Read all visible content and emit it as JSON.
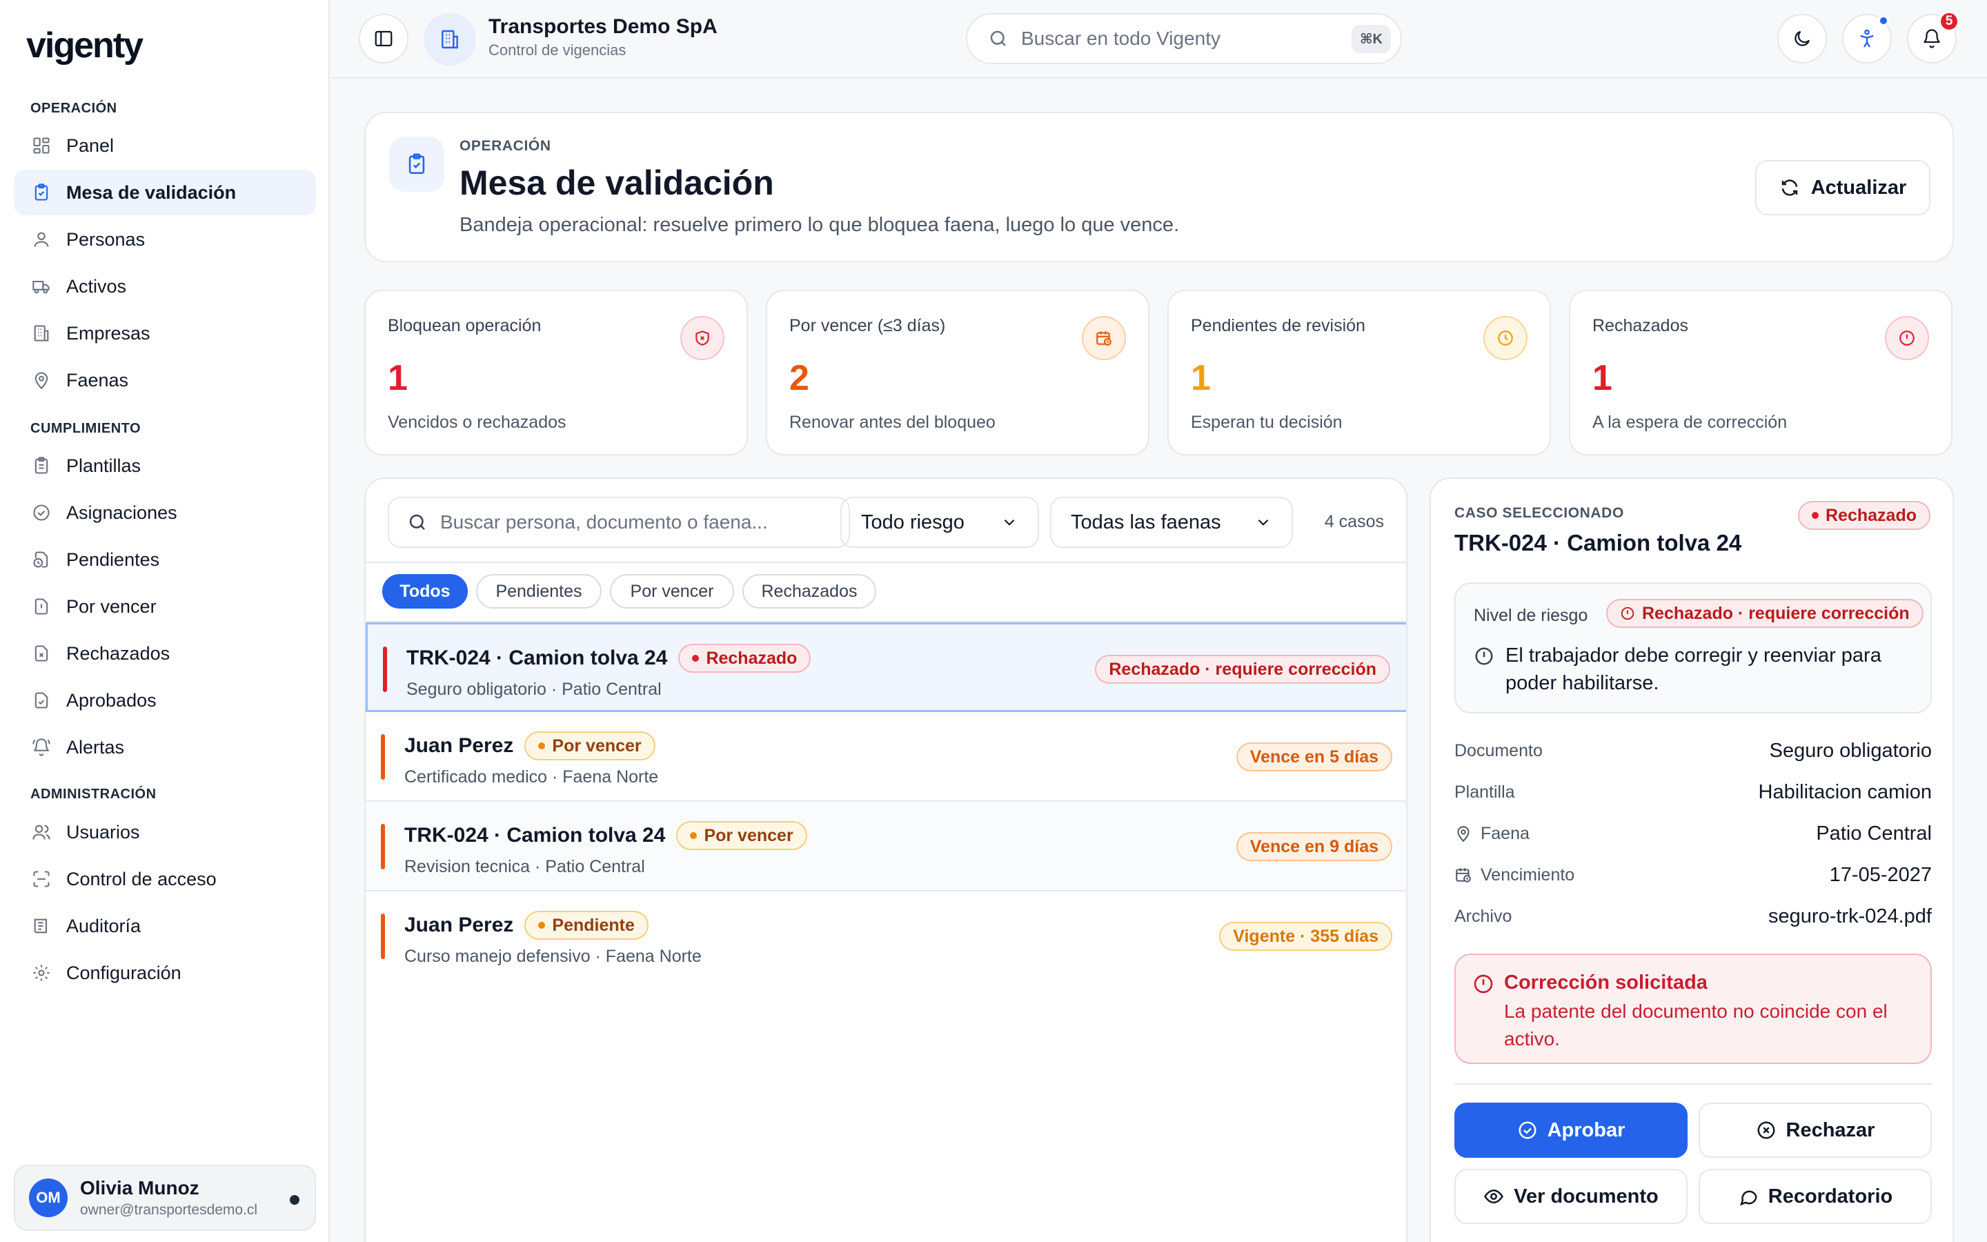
{
  "app": {
    "logo": "vigenty",
    "org_name": "Transportes Demo SpA",
    "org_subtitle": "Control de vigencias",
    "search_placeholder": "Buscar en todo Vigenty",
    "search_shortcut": "⌘K",
    "notifications_count": "5",
    "accent": "#2563eb"
  },
  "sidebar": {
    "sections": [
      {
        "title": "OPERACIÓN",
        "items": [
          {
            "label": "Panel",
            "icon": "dashboard-icon"
          },
          {
            "label": "Mesa de validación",
            "icon": "clipboard-check-icon",
            "active": true
          },
          {
            "label": "Personas",
            "icon": "user-icon"
          },
          {
            "label": "Activos",
            "icon": "truck-icon"
          },
          {
            "label": "Empresas",
            "icon": "building-icon"
          },
          {
            "label": "Faenas",
            "icon": "map-pin-icon"
          }
        ]
      },
      {
        "title": "CUMPLIMIENTO",
        "items": [
          {
            "label": "Plantillas",
            "icon": "clipboard-list-icon"
          },
          {
            "label": "Asignaciones",
            "icon": "check-circle-icon"
          },
          {
            "label": "Pendientes",
            "icon": "file-clock-icon"
          },
          {
            "label": "Por vencer",
            "icon": "file-alert-icon"
          },
          {
            "label": "Rechazados",
            "icon": "file-x-icon"
          },
          {
            "label": "Aprobados",
            "icon": "file-check-icon"
          },
          {
            "label": "Alertas",
            "icon": "bell-ring-icon"
          }
        ]
      },
      {
        "title": "ADMINISTRACIÓN",
        "items": [
          {
            "label": "Usuarios",
            "icon": "users-icon"
          },
          {
            "label": "Control de acceso",
            "icon": "scan-icon"
          },
          {
            "label": "Auditoría",
            "icon": "audit-list-icon"
          },
          {
            "label": "Configuración",
            "icon": "gear-icon"
          }
        ]
      }
    ],
    "user": {
      "initials": "OM",
      "name": "Olivia Munoz",
      "email": "owner@transportesdemo.cl"
    }
  },
  "header": {
    "eyebrow": "OPERACIÓN",
    "title": "Mesa de validación",
    "description": "Bandeja operacional: resuelve primero lo que bloquea faena, luego lo que vence.",
    "refresh_label": "Actualizar"
  },
  "stats": [
    {
      "label": "Bloquean operación",
      "value": "1",
      "sub": "Vencidos o rechazados",
      "icon": "shield-x-icon",
      "color": "#e11d2e"
    },
    {
      "label": "Por vencer (≤3 días)",
      "value": "2",
      "sub": "Renovar antes del bloqueo",
      "icon": "calendar-clock-icon",
      "color": "#ea580c"
    },
    {
      "label": "Pendientes de revisión",
      "value": "1",
      "sub": "Esperan tu decisión",
      "icon": "clock-icon",
      "color": "#f59e0b"
    },
    {
      "label": "Rechazados",
      "value": "1",
      "sub": "A la espera de corrección",
      "icon": "alert-circle-icon",
      "color": "#e11d2e"
    }
  ],
  "list": {
    "search_placeholder": "Buscar persona, documento o faena...",
    "risk_filter": "Todo riesgo",
    "site_filter": "Todas las faenas",
    "count": "4 casos",
    "tabs": [
      "Todos",
      "Pendientes",
      "Por vencer",
      "Rechazados"
    ],
    "active_tab": 0,
    "rows": [
      {
        "title": "TRK-024 · Camion tolva 24",
        "status": "Rechazado",
        "meta": "Seguro obligatorio · Patio Central",
        "tag": "Rechazado · requiere corrección"
      },
      {
        "title": "Juan Perez",
        "status": "Por vencer",
        "meta": "Certificado medico · Faena Norte",
        "tag": "Vence en 5 días"
      },
      {
        "title": "TRK-024 · Camion tolva 24",
        "status": "Por vencer",
        "meta": "Revision tecnica · Patio Central",
        "tag": "Vence en 9 días"
      },
      {
        "title": "Juan Perez",
        "status": "Pendiente",
        "meta": "Curso manejo defensivo · Faena Norte",
        "tag": "Vigente · 355 días"
      }
    ]
  },
  "detail": {
    "eyebrow": "CASO SELECCIONADO",
    "title": "TRK-024 · Camion tolva 24",
    "status": "Rechazado",
    "risk_label": "Nivel de riesgo",
    "risk_tag": "Rechazado · requiere corrección",
    "risk_message": "El trabajador debe corregir y reenviar para poder habilitarse.",
    "fields": [
      {
        "key": "Documento",
        "value": "Seguro obligatorio"
      },
      {
        "key": "Plantilla",
        "value": "Habilitacion camion"
      },
      {
        "key": "Faena",
        "value": "Patio Central"
      },
      {
        "key": "Vencimiento",
        "value": "17-05-2027"
      },
      {
        "key": "Archivo",
        "value": "seguro-trk-024.pdf"
      }
    ],
    "correction_title": "Corrección solicitada",
    "correction_text": "La patente del documento no coincide con el activo.",
    "actions": {
      "approve": "Aprobar",
      "reject": "Rechazar",
      "view": "Ver documento",
      "remind": "Recordatorio"
    }
  }
}
